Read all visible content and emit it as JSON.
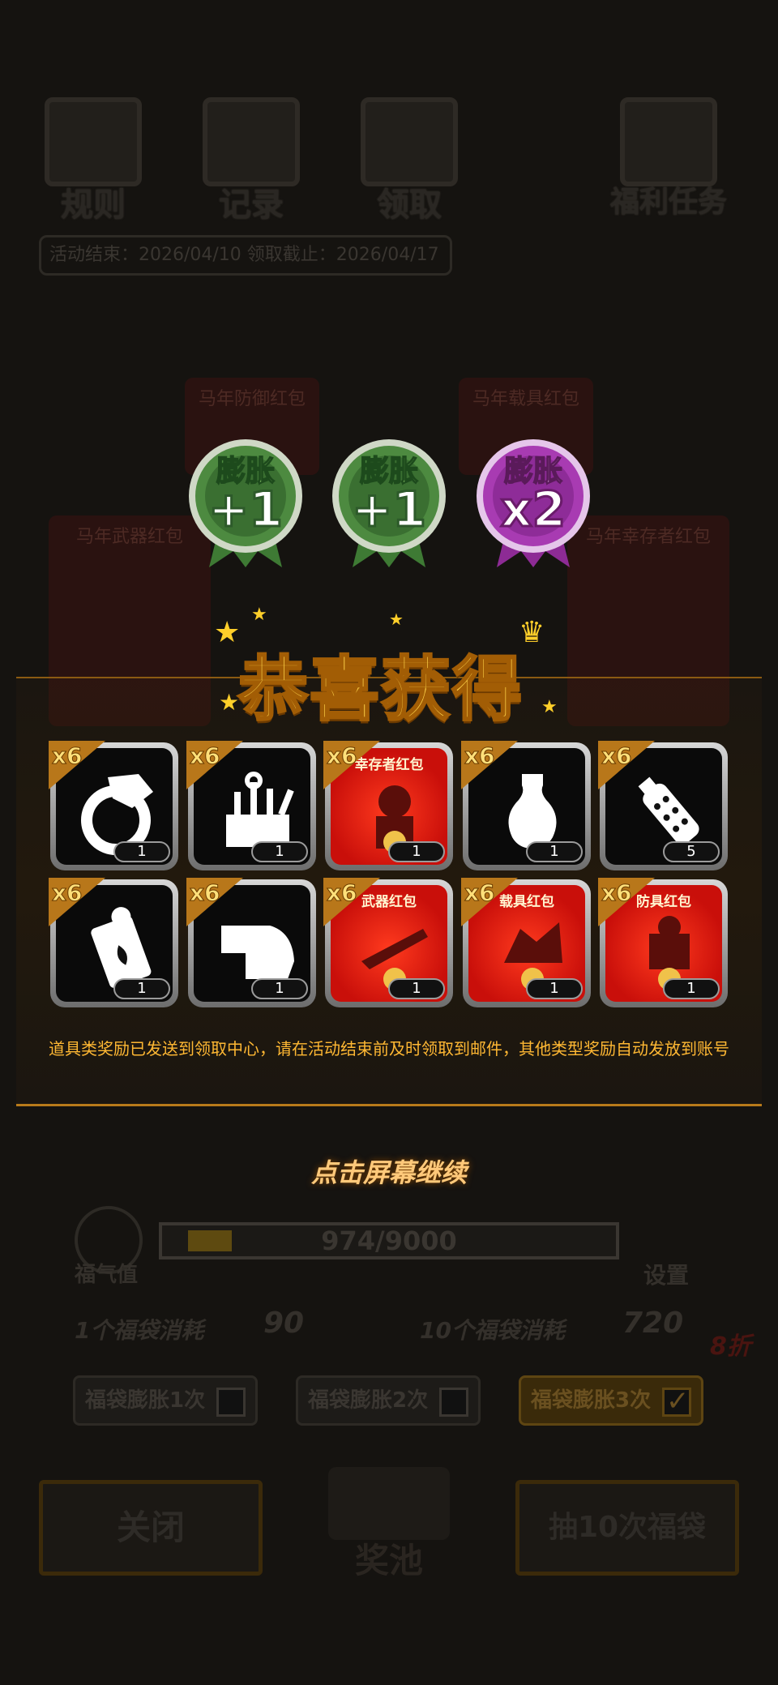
{
  "top_menu": {
    "rules": "规则",
    "records": "记录",
    "claim": "领取",
    "welfare_tasks": "福利任务"
  },
  "dates": "活动结束：2026/04/10   领取截止：2026/04/17",
  "bg_panels": {
    "p1": "马年防御红包",
    "p2": "马年载具红包",
    "p3": "马年武器红包",
    "p4": "马年幸存者红包"
  },
  "badges": [
    {
      "label": "膨胀",
      "value": "+1",
      "color": "#5aa24a"
    },
    {
      "label": "膨胀",
      "value": "+1",
      "color": "#5aa24a"
    },
    {
      "label": "膨胀",
      "value": "x2",
      "color": "#a63ab0"
    }
  ],
  "title": "恭喜获得",
  "rewards": [
    {
      "mult": "x6",
      "qty": "1",
      "icon": "ring-icon",
      "name": ""
    },
    {
      "mult": "x6",
      "qty": "1",
      "icon": "toolbox-icon",
      "name": ""
    },
    {
      "mult": "x6",
      "qty": "1",
      "icon": "survivor-red-packet-icon",
      "name": "幸存者红包"
    },
    {
      "mult": "x6",
      "qty": "1",
      "icon": "vase-icon",
      "name": ""
    },
    {
      "mult": "x6",
      "qty": "5",
      "icon": "grenade-icon",
      "name": ""
    },
    {
      "mult": "x6",
      "qty": "1",
      "icon": "fuel-canister-icon",
      "name": ""
    },
    {
      "mult": "x6",
      "qty": "1",
      "icon": "cloth-icon",
      "name": ""
    },
    {
      "mult": "x6",
      "qty": "1",
      "icon": "weapon-red-packet-icon",
      "name": "武器红包"
    },
    {
      "mult": "x6",
      "qty": "1",
      "icon": "vehicle-red-packet-icon",
      "name": "载具红包"
    },
    {
      "mult": "x6",
      "qty": "1",
      "icon": "defense-red-packet-icon",
      "name": "防具红包"
    }
  ],
  "notice": "道具类奖励已发送到领取中心，请在活动结束前及时领取到邮件，其他类型奖励自动发放到账号",
  "tap_continue": "点击屏幕继续",
  "luck": {
    "label": "福气值",
    "progress_text": "974/9000",
    "progress": 0.108
  },
  "settings": "设置",
  "cost_one": {
    "label": "1个福袋消耗",
    "value": "90"
  },
  "cost_ten": {
    "label": "10个福袋消耗",
    "value": "720",
    "discount": "8折"
  },
  "options": [
    {
      "label": "福袋膨胀1次",
      "checked": false
    },
    {
      "label": "福袋膨胀2次",
      "checked": false
    },
    {
      "label": "福袋膨胀3次",
      "checked": true
    }
  ],
  "buttons": {
    "close": "关闭",
    "pool": "奖池",
    "draw10": "抽10次福袋"
  },
  "colors": {
    "gold": "#ffd34a",
    "notice": "#ffb833",
    "red_packet": "#d8140e"
  }
}
